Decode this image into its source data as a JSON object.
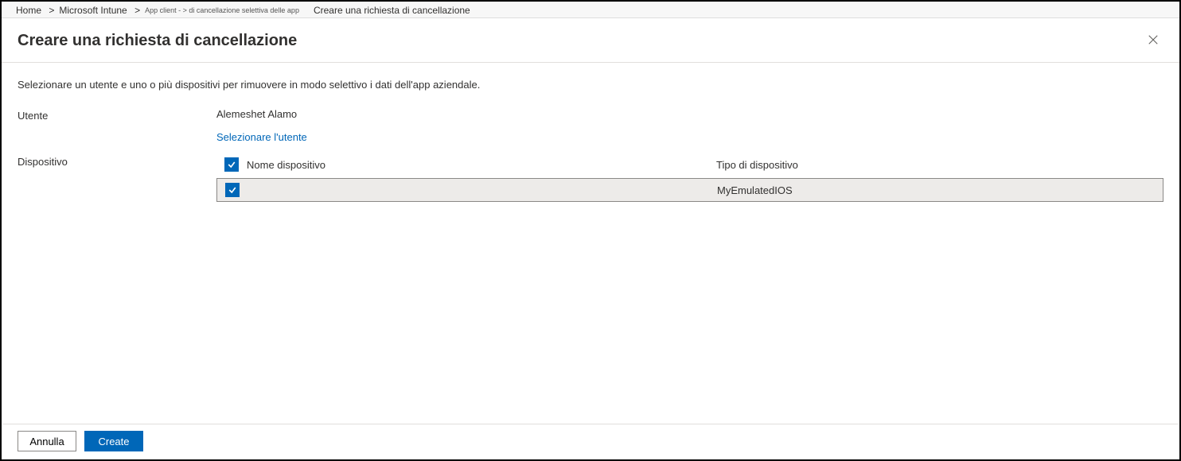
{
  "breadcrumb": {
    "items": [
      {
        "label": "Home"
      },
      {
        "label": "Microsoft Intune"
      },
      {
        "label": "App client - > di cancellazione selettiva delle app"
      }
    ],
    "sep": " >",
    "current": "Creare una richiesta di cancellazione"
  },
  "header": {
    "title": "Creare una richiesta di cancellazione"
  },
  "content": {
    "description": "Selezionare un utente e uno o più dispositivi per rimuovere in modo selettivo i dati dell'app aziendale.",
    "user_label": "Utente",
    "user_name": "Alemeshet Alamo",
    "select_user": "Selezionare l'utente",
    "device_label": "Dispositivo",
    "device_table": {
      "header_name": "Nome dispositivo",
      "header_type": "Tipo di dispositivo",
      "rows": [
        {
          "name": "",
          "type": "MyEmulatedIOS"
        }
      ]
    }
  },
  "footer": {
    "cancel": "Annulla",
    "create": "Create"
  }
}
